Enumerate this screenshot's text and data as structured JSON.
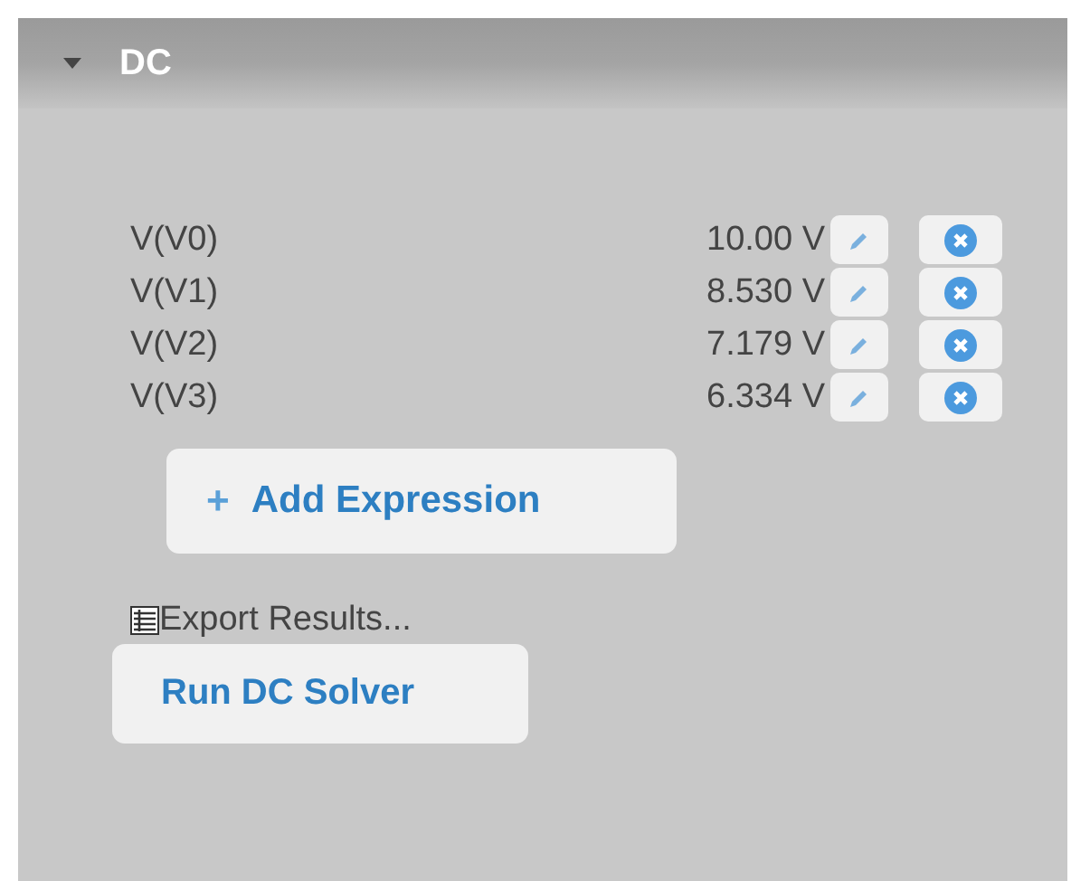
{
  "section": {
    "title": "DC",
    "expanded": true
  },
  "expressions": [
    {
      "name": "V(V0)",
      "value": "10.00 V"
    },
    {
      "name": "V(V1)",
      "value": "8.530 V"
    },
    {
      "name": "V(V2)",
      "value": "7.179 V"
    },
    {
      "name": "V(V3)",
      "value": "6.334 V"
    }
  ],
  "add_button": {
    "icon": "+",
    "label": "Add Expression"
  },
  "export_link": "Export Results...",
  "run_button": "Run DC Solver"
}
